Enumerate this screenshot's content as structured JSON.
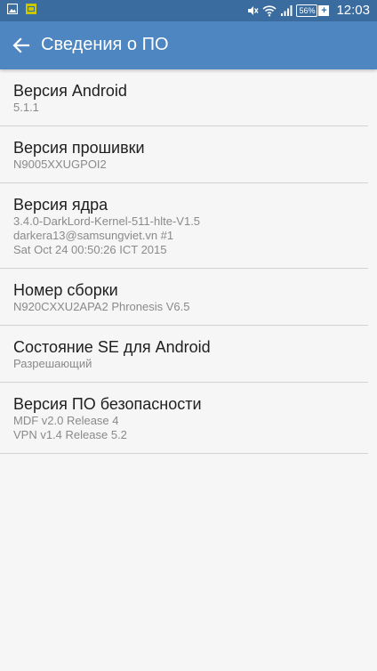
{
  "status_bar": {
    "battery_percent": "56%",
    "battery_plus": "+",
    "time": "12:03",
    "icons": [
      "gallery-icon",
      "sim-badge-icon",
      "mute-icon",
      "wifi-icon",
      "signal-icon"
    ]
  },
  "app_bar": {
    "title": "Сведения о ПО",
    "back_icon": "arrow-left-icon"
  },
  "items": [
    {
      "title": "Версия Android",
      "lines": [
        "5.1.1"
      ]
    },
    {
      "title": "Версия прошивки",
      "lines": [
        "N9005XXUGPOI2"
      ]
    },
    {
      "title": "Версия ядра",
      "lines": [
        "3.4.0-DarkLord-Kernel-511-hlte-V1.5",
        "darkera13@samsungviet.vn #1",
        "Sat Oct 24 00:50:26 ICT 2015"
      ]
    },
    {
      "title": "Номер сборки",
      "lines": [
        "N920CXXU2APA2 Phronesis V6.5"
      ]
    },
    {
      "title": "Состояние SE для Android",
      "lines": [
        "Разрешающий"
      ]
    },
    {
      "title": "Версия ПО безопасности",
      "lines": [
        "MDF v2.0 Release 4",
        "VPN v1.4 Release 5.2"
      ]
    }
  ],
  "colors": {
    "status_bar": "#3a6c9f",
    "app_bar": "#4d86c1",
    "background": "#f6f6f6",
    "divider": "#d2d2d2",
    "title_text": "#202020",
    "subtitle_text": "#8a8a8a",
    "sim_badge": "#c7c700"
  }
}
